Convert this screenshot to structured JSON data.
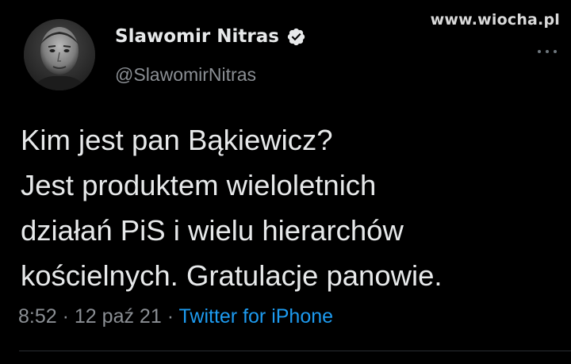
{
  "watermark": "www.wiocha.pl",
  "author": {
    "name": "Slawomir Nitras",
    "handle": "@SlawomirNitras",
    "verified": true,
    "verified_icon": "verified-badge-icon"
  },
  "tweet": {
    "lines": [
      "Kim jest pan Bąkiewicz?",
      "Jest produktem wieloletnich",
      "działań PiS i wielu hierarchów",
      "kościelnych. Gratulacje panowie."
    ]
  },
  "meta": {
    "time": "8:52",
    "separator": "·",
    "date": "12 paź 21",
    "source": "Twitter for iPhone"
  },
  "colors": {
    "background": "#000000",
    "text": "#e7e9ea",
    "secondary": "#8b8f94",
    "link": "#1d9bf0"
  }
}
